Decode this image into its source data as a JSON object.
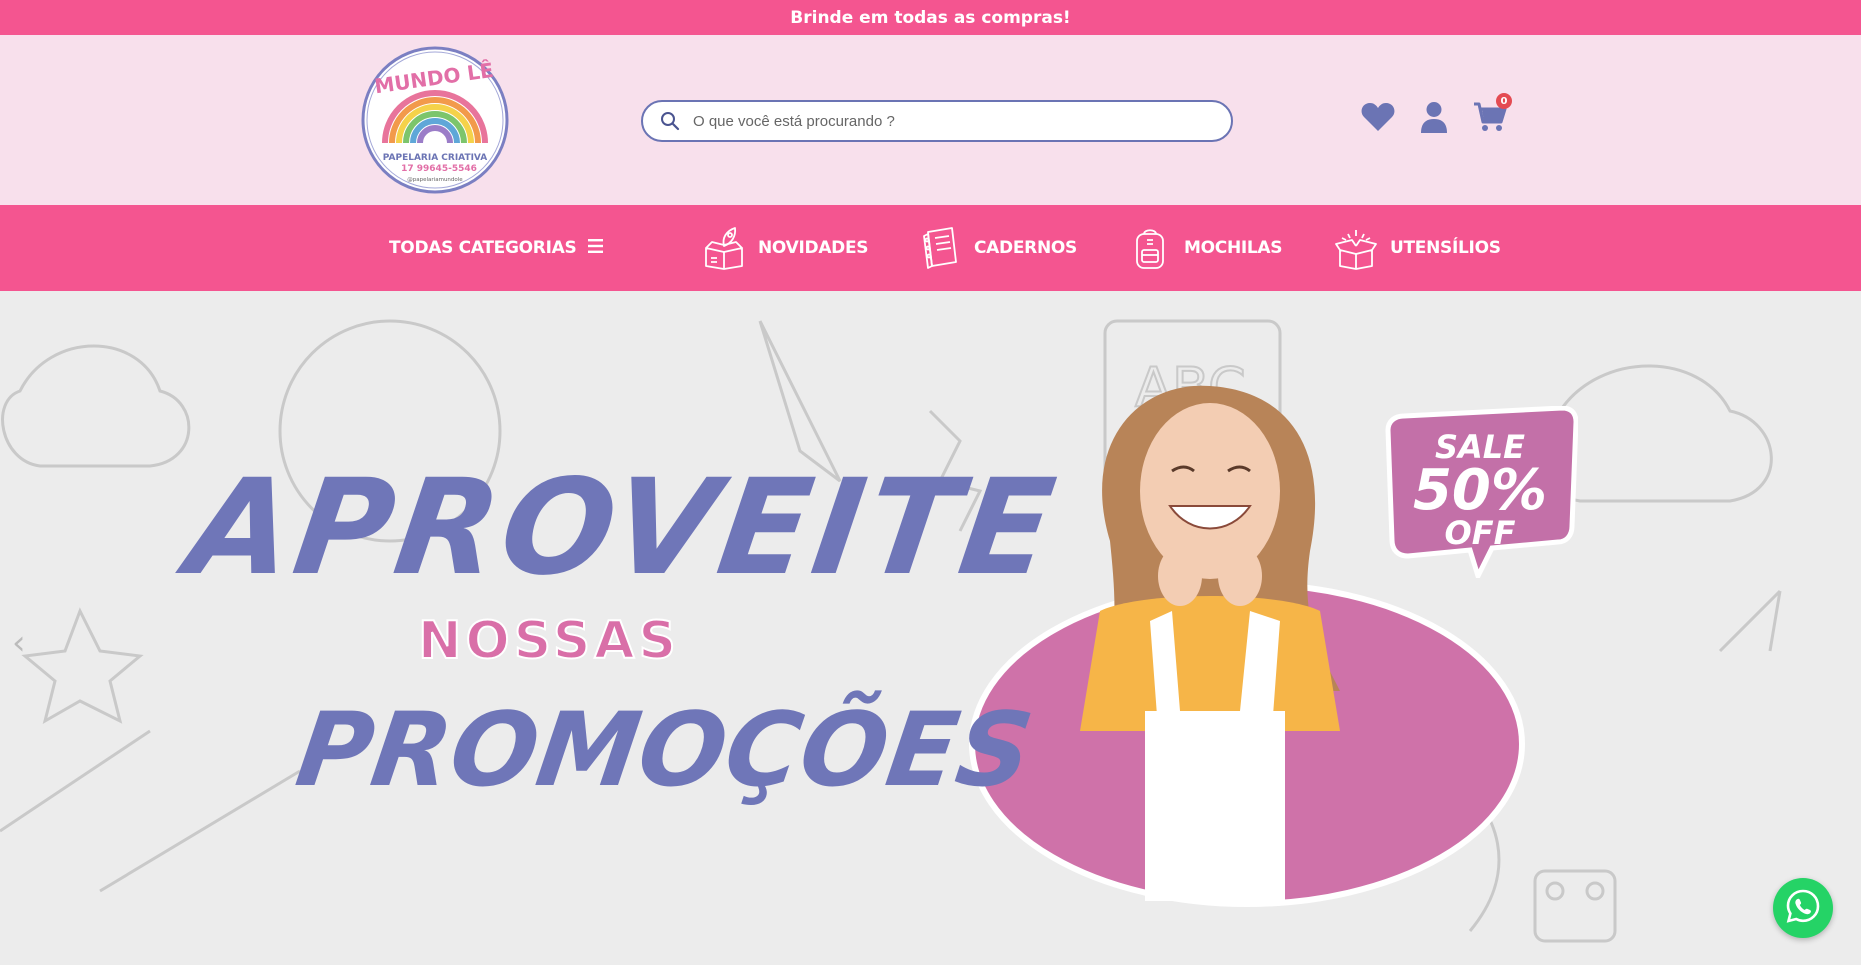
{
  "topbar": {
    "text": "Brinde em todas as compras!"
  },
  "logo": {
    "brand": "MUNDO LÊ",
    "tagline": "PAPELARIA CRIATIVA",
    "phone": "17 99645-5546",
    "handle": "@papelariamundole"
  },
  "search": {
    "placeholder": "O que você está procurando ?"
  },
  "header_icons": {
    "wishlist": "heart-icon",
    "account": "user-icon",
    "cart": "cart-icon",
    "cart_count": "0"
  },
  "nav": {
    "all_categories": "TODAS CATEGORIAS",
    "items": [
      {
        "label": "NOVIDADES",
        "icon": "rocket-box-icon"
      },
      {
        "label": "CADERNOS",
        "icon": "notebook-icon"
      },
      {
        "label": "MOCHILAS",
        "icon": "backpack-icon"
      },
      {
        "label": "UTENSÍLIOS",
        "icon": "gift-box-icon"
      }
    ]
  },
  "hero": {
    "line1": "APROVEITE",
    "line2": "NOSSAS",
    "line3": "PROMOÇÕES",
    "badge_line1": "SALE",
    "badge_line2": "50%",
    "badge_line3": "OFF",
    "prev_arrow": "‹"
  },
  "colors": {
    "brand_pink": "#f45590",
    "header_bg": "#f8e0ec",
    "icon_purple": "#6b74b4",
    "hero_purple": "#6f76b8",
    "hero_pink": "#d96fa8",
    "whatsapp_green": "#25d366"
  }
}
